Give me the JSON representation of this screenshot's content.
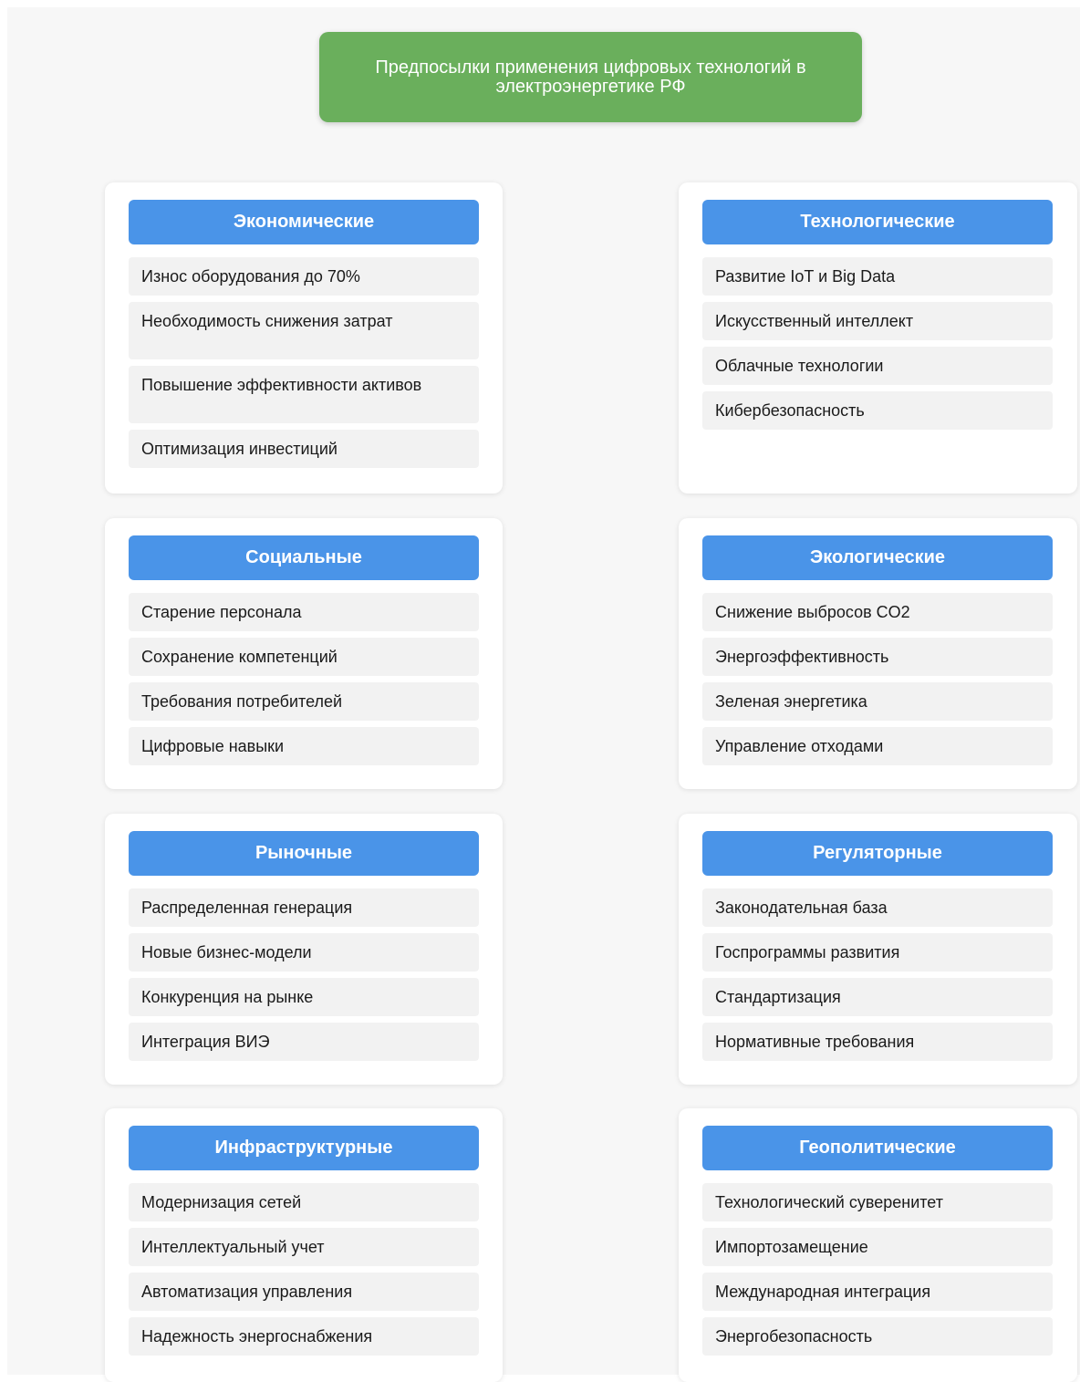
{
  "title": "Предпосылки применения цифровых технологий в электроэнергетике РФ",
  "colors": {
    "title_bg": "#6aaf5c",
    "header_bg": "#4a94e8",
    "item_bg": "#f2f2f2",
    "card_bg": "#ffffff",
    "page_bg": "#f7f7f7"
  },
  "categories": [
    {
      "name": "Экономические",
      "items": [
        "Износ оборудования до 70%",
        "Необходимость снижения затрат",
        "Повышение эффективности активов",
        "Оптимизация инвестиций"
      ]
    },
    {
      "name": "Технологические",
      "items": [
        "Развитие IoT и Big Data",
        "Искусственный интеллект",
        "Облачные технологии",
        "Кибербезопасность"
      ]
    },
    {
      "name": "Социальные",
      "items": [
        "Старение персонала",
        "Сохранение компетенций",
        "Требования потребителей",
        "Цифровые навыки"
      ]
    },
    {
      "name": "Экологические",
      "items": [
        "Снижение выбросов CO2",
        "Энергоэффективность",
        "Зеленая энергетика",
        "Управление отходами"
      ]
    },
    {
      "name": "Рыночные",
      "items": [
        "Распределенная генерация",
        "Новые бизнес-модели",
        "Конкуренция на рынке",
        "Интеграция ВИЭ"
      ]
    },
    {
      "name": "Регуляторные",
      "items": [
        "Законодательная база",
        "Госпрограммы развития",
        "Стандартизация",
        "Нормативные требования"
      ]
    },
    {
      "name": "Инфраструктурные",
      "items": [
        "Модернизация сетей",
        "Интеллектуальный учет",
        "Автоматизация управления",
        "Надежность энергоснабжения"
      ]
    },
    {
      "name": "Геополитические",
      "items": [
        "Технологический суверенитет",
        "Импортозамещение",
        "Международная интеграция",
        "Энергобезопасность"
      ]
    }
  ]
}
